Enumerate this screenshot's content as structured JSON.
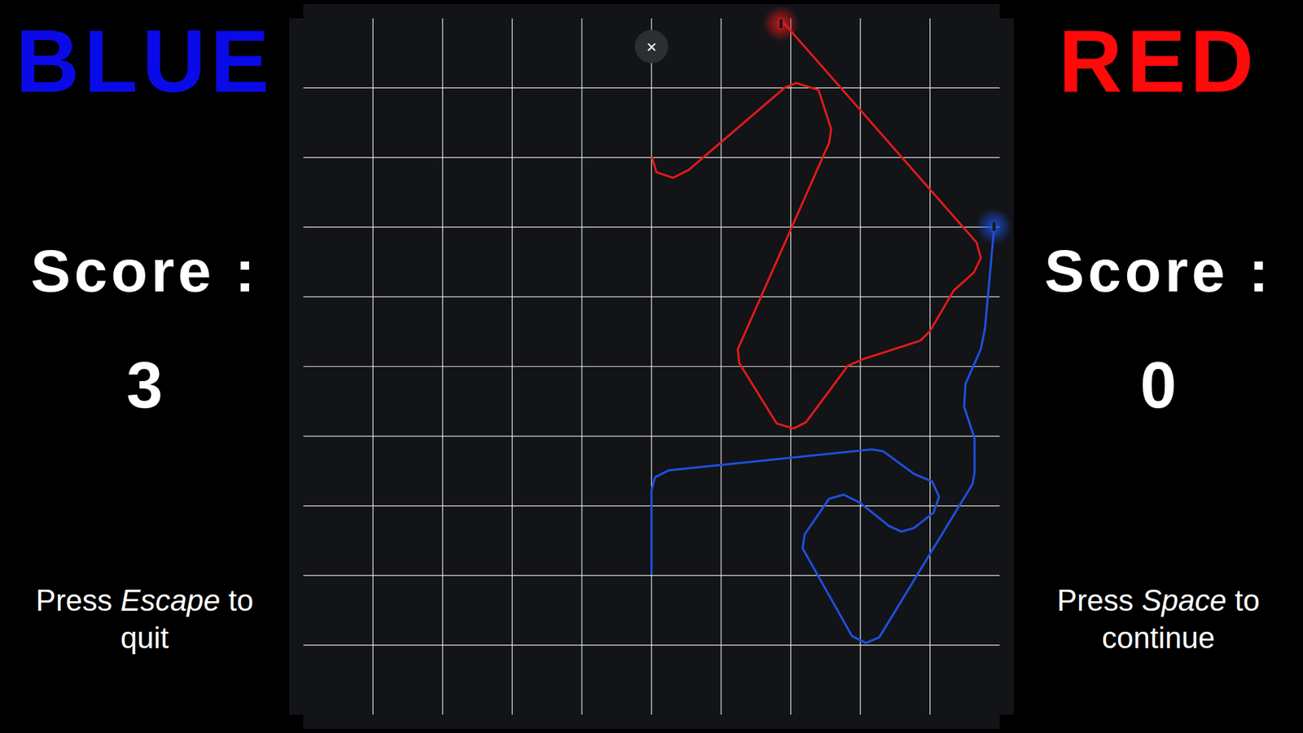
{
  "players": [
    {
      "name": "BLUE",
      "color": "#0a0ae8",
      "score_label": "Score :",
      "score": "3",
      "hint": {
        "before": "Press ",
        "key": "Escape",
        "after": " to quit"
      }
    },
    {
      "name": "RED",
      "color": "#ff0a0a",
      "score_label": "Score :",
      "score": "0",
      "hint": {
        "before": "Press ",
        "key": "Space",
        "after": " to continue"
      }
    }
  ],
  "board": {
    "close": "×",
    "cols": 10,
    "rows": 10,
    "trails": [
      {
        "player": "RED",
        "color": "#e01a1a",
        "points": [
          [
            5.01,
            2.0
          ],
          [
            5.07,
            2.21
          ],
          [
            5.31,
            2.29
          ],
          [
            5.53,
            2.18
          ],
          [
            6.92,
            0.99
          ],
          [
            7.08,
            0.93
          ],
          [
            7.4,
            1.03
          ],
          [
            7.58,
            1.59
          ],
          [
            7.55,
            1.79
          ],
          [
            6.24,
            4.75
          ],
          [
            6.26,
            4.95
          ],
          [
            6.8,
            5.82
          ],
          [
            7.04,
            5.89
          ],
          [
            7.22,
            5.8
          ],
          [
            7.82,
            4.99
          ],
          [
            8.05,
            4.89
          ],
          [
            8.86,
            4.63
          ],
          [
            9.0,
            4.49
          ],
          [
            9.34,
            3.91
          ],
          [
            9.63,
            3.65
          ],
          [
            9.73,
            3.44
          ],
          [
            9.67,
            3.22
          ],
          [
            6.93,
            0.1
          ],
          [
            6.86,
            0.03
          ]
        ]
      },
      {
        "player": "BLUE",
        "color": "#1f4fe0",
        "points": [
          [
            5.0,
            7.97
          ],
          [
            5.0,
            6.78
          ],
          [
            5.05,
            6.59
          ],
          [
            5.25,
            6.49
          ],
          [
            8.17,
            6.19
          ],
          [
            8.33,
            6.22
          ],
          [
            8.77,
            6.54
          ],
          [
            9.03,
            6.65
          ],
          [
            9.13,
            6.87
          ],
          [
            9.05,
            7.1
          ],
          [
            8.77,
            7.32
          ],
          [
            8.59,
            7.37
          ],
          [
            8.41,
            7.29
          ],
          [
            8.0,
            6.96
          ],
          [
            7.76,
            6.84
          ],
          [
            7.55,
            6.9
          ],
          [
            7.2,
            7.41
          ],
          [
            7.17,
            7.61
          ],
          [
            7.88,
            8.87
          ],
          [
            8.08,
            8.97
          ],
          [
            8.27,
            8.89
          ],
          [
            9.61,
            6.69
          ],
          [
            9.64,
            6.52
          ],
          [
            9.64,
            6.03
          ],
          [
            9.49,
            5.58
          ],
          [
            9.51,
            5.25
          ],
          [
            9.73,
            4.75
          ],
          [
            9.79,
            4.45
          ],
          [
            9.92,
            3.02
          ],
          [
            9.92,
            2.94
          ]
        ]
      }
    ]
  }
}
